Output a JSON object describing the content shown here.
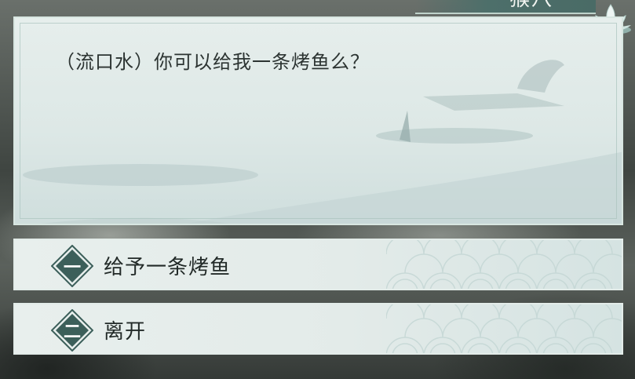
{
  "dialog": {
    "speaker_name": "猴八",
    "line": "（流口水）你可以给我一条烤鱼么？"
  },
  "choices": [
    {
      "number": "一",
      "label": "给予一条烤鱼"
    },
    {
      "number": "二",
      "label": "离开"
    }
  ],
  "colors": {
    "panel": "#e3ebe9",
    "badge": "#3c5f5a",
    "text": "#222a28",
    "name_tab": "#4d6f6a"
  }
}
